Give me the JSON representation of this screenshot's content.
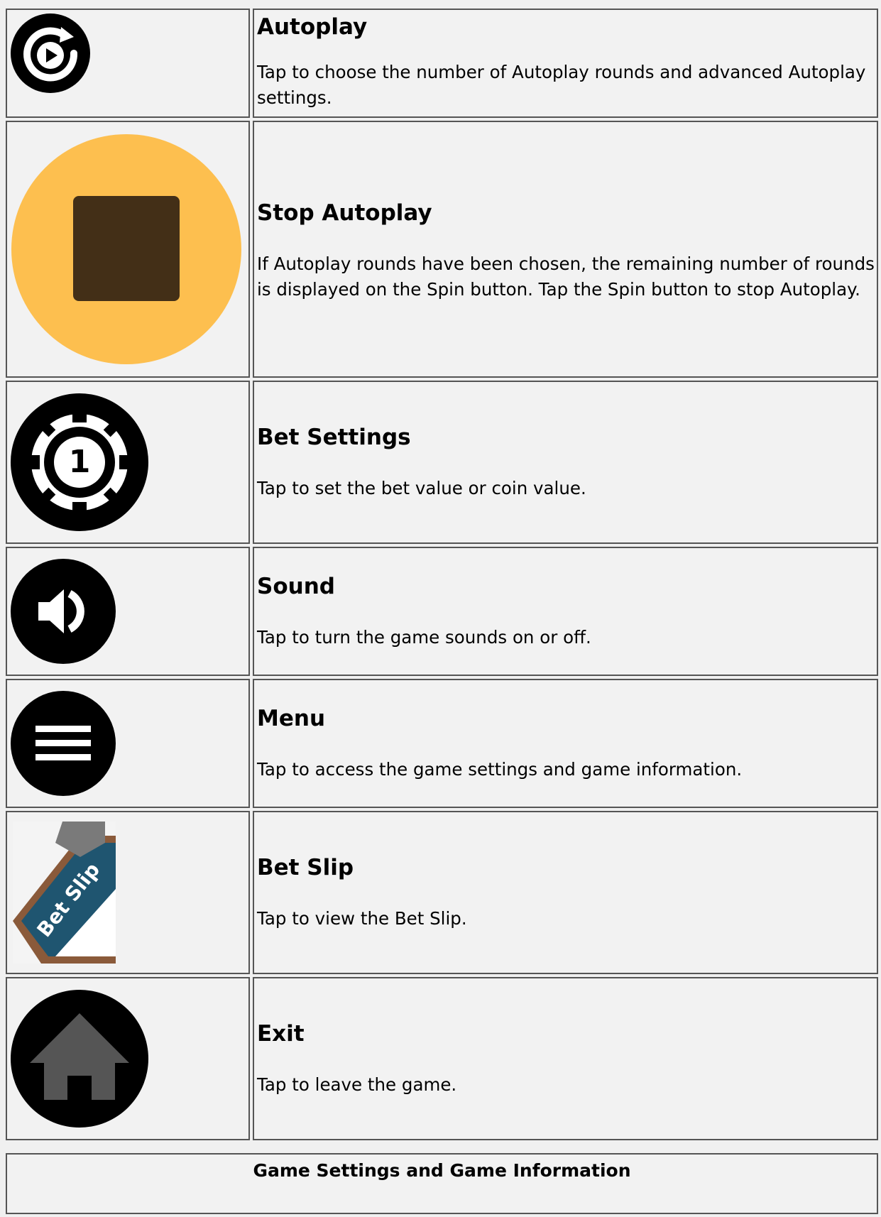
{
  "rows": [
    {
      "icon": "autoplay-icon",
      "title": "Autoplay",
      "description": "Tap to choose the number of Autoplay rounds and advanced Autoplay settings."
    },
    {
      "icon": "stop-icon",
      "title": "Stop Autoplay",
      "description": "If Autoplay rounds have been chosen, the remaining number of rounds is displayed on the Spin button. Tap the Spin button to stop Autoplay."
    },
    {
      "icon": "chip-icon",
      "title": "Bet Settings",
      "description": "Tap to set the bet value or coin value.",
      "chip_label": "1"
    },
    {
      "icon": "sound-icon",
      "title": "Sound",
      "description": "Tap to turn the game sounds on or off."
    },
    {
      "icon": "menu-icon",
      "title": "Menu",
      "description": "Tap to access the game settings and game information."
    },
    {
      "icon": "bet-slip-icon",
      "title": "Bet Slip",
      "description": "Tap to view the Bet Slip.",
      "icon_text": "Bet Slip"
    },
    {
      "icon": "home-icon",
      "title": "Exit",
      "description": "Tap to leave the game."
    }
  ],
  "footer": {
    "title": "Game Settings and Game Information"
  },
  "colors": {
    "stop_circle": "#fdbf4f",
    "stop_square": "#432f17",
    "icon_dark": "#000000",
    "home_fill": "#555555"
  }
}
